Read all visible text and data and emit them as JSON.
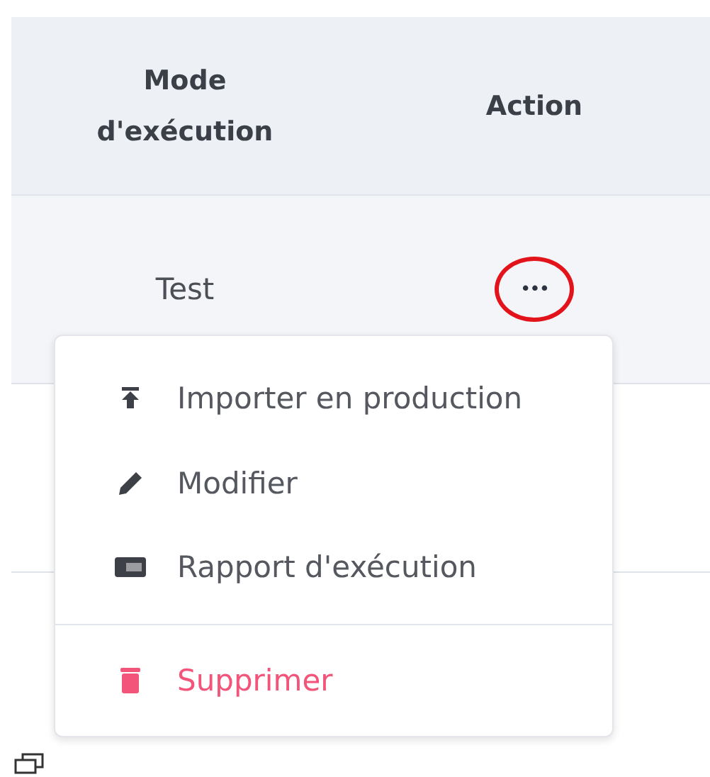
{
  "table": {
    "columns": [
      "Mode\nd'exécution",
      "Action"
    ],
    "rows": [
      {
        "mode": "Test",
        "action": {
          "label": "•••",
          "circled": true
        }
      }
    ]
  },
  "menu": {
    "items": [
      {
        "kind": "upload",
        "label": "Importer en production",
        "danger": false
      },
      {
        "kind": "edit",
        "label": "Modifier",
        "danger": false
      },
      {
        "kind": "report",
        "label": "Rapport d'exécution",
        "danger": false
      },
      {
        "kind": "delete",
        "label": "Supprimer",
        "danger": true
      }
    ]
  }
}
